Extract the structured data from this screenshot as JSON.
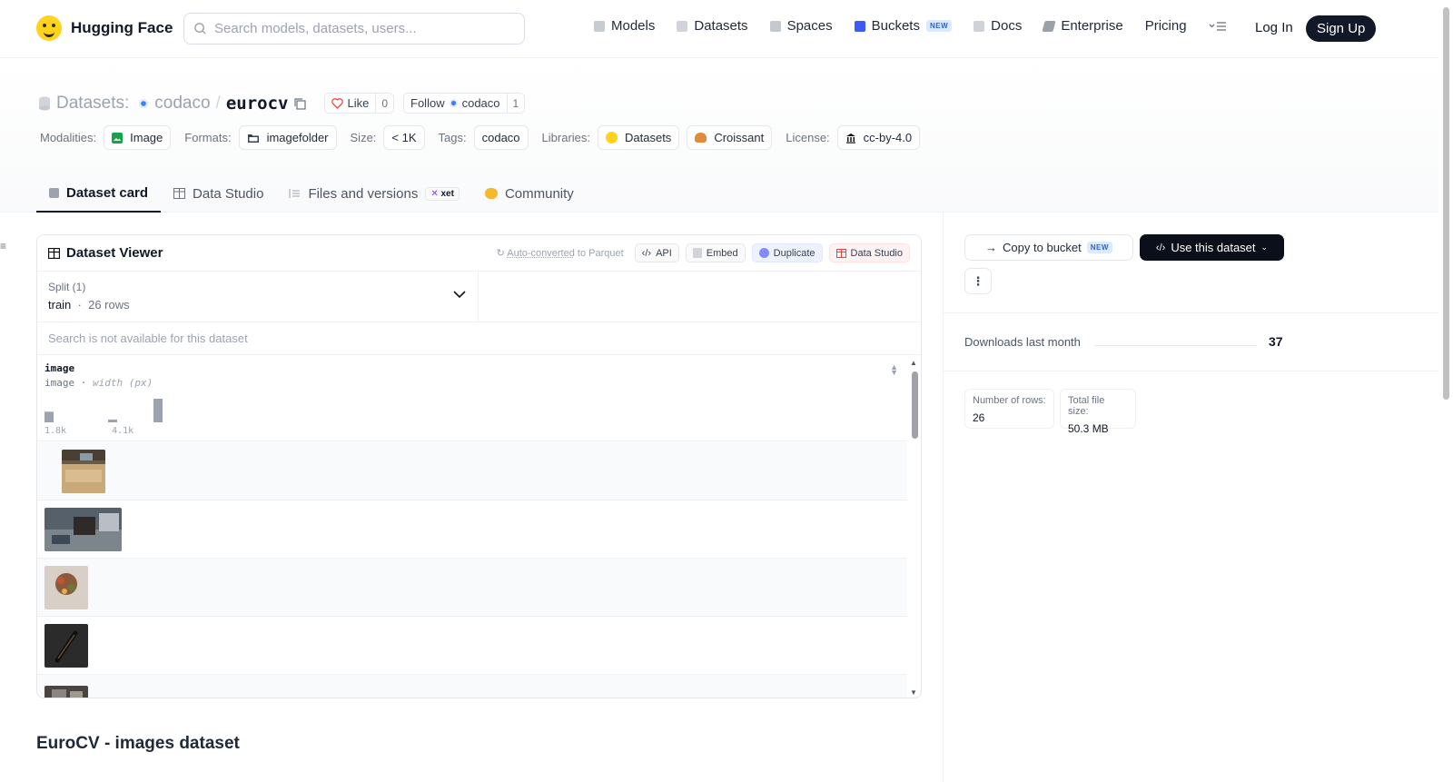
{
  "header": {
    "brand": "Hugging Face",
    "search_placeholder": "Search models, datasets, users...",
    "nav": [
      {
        "label": "Models",
        "icon": "cube-icon"
      },
      {
        "label": "Datasets",
        "icon": "database-icon"
      },
      {
        "label": "Spaces",
        "icon": "grid-icon"
      },
      {
        "label": "Buckets",
        "icon": "bucket-icon",
        "badge": "NEW"
      },
      {
        "label": "Docs",
        "icon": "book-icon"
      },
      {
        "label": "Enterprise",
        "icon": "enterprise-icon"
      },
      {
        "label": "Pricing"
      }
    ],
    "login": "Log In",
    "signup": "Sign Up"
  },
  "repo": {
    "type_label": "Datasets:",
    "owner": "codaco",
    "separator": "/",
    "name": "eurocv",
    "like_label": "Like",
    "like_count": "0",
    "follow_label": "Follow",
    "follow_owner": "codaco",
    "follow_count": "1",
    "meta": {
      "modalities_label": "Modalities:",
      "modality": "Image",
      "formats_label": "Formats:",
      "format": "imagefolder",
      "size_label": "Size:",
      "size": "< 1K",
      "tags_label": "Tags:",
      "tag": "codaco",
      "libraries_label": "Libraries:",
      "library_1": "Datasets",
      "library_2": "Croissant",
      "license_label": "License:",
      "license": "cc-by-4.0"
    },
    "tabs": [
      {
        "label": "Dataset card",
        "active": true
      },
      {
        "label": "Data Studio"
      },
      {
        "label": "Files and versions",
        "badge": "xet"
      },
      {
        "label": "Community"
      }
    ]
  },
  "viewer": {
    "title": "Dataset Viewer",
    "auto_prefix": "Auto-converted",
    "auto_suffix": "to Parquet",
    "buttons": {
      "api": "API",
      "embed": "Embed",
      "duplicate": "Duplicate",
      "data_studio": "Data Studio"
    },
    "split_label": "Split (1)",
    "split_name": "train",
    "split_rows": "26 rows",
    "search_disabled": "Search is not available for this dataset",
    "column": {
      "name": "image",
      "type": "image",
      "stat": "width (px)",
      "min_label": "1.8k",
      "max_label": "4.1k"
    },
    "histogram": [
      0.45,
      0.0,
      0.0,
      0.0,
      0.0,
      0.0,
      0.0,
      0.12,
      0.0,
      0.0,
      0.0,
      0.0,
      1.0
    ]
  },
  "readme": {
    "title": "EuroCV - images dataset"
  },
  "sidebar": {
    "copy_bucket": "Copy to bucket",
    "copy_badge": "NEW",
    "use_dataset": "Use this dataset",
    "downloads_label": "Downloads last month",
    "downloads_value": "37",
    "rows_label": "Number of rows:",
    "rows_value": "26",
    "size_label": "Total file size:",
    "size_value": "50.3 MB"
  },
  "colors": {
    "accent_dark": "#0b0f19",
    "like_heart": "#ef4444",
    "dup": "#6366f1",
    "studio": "#ef4444"
  }
}
